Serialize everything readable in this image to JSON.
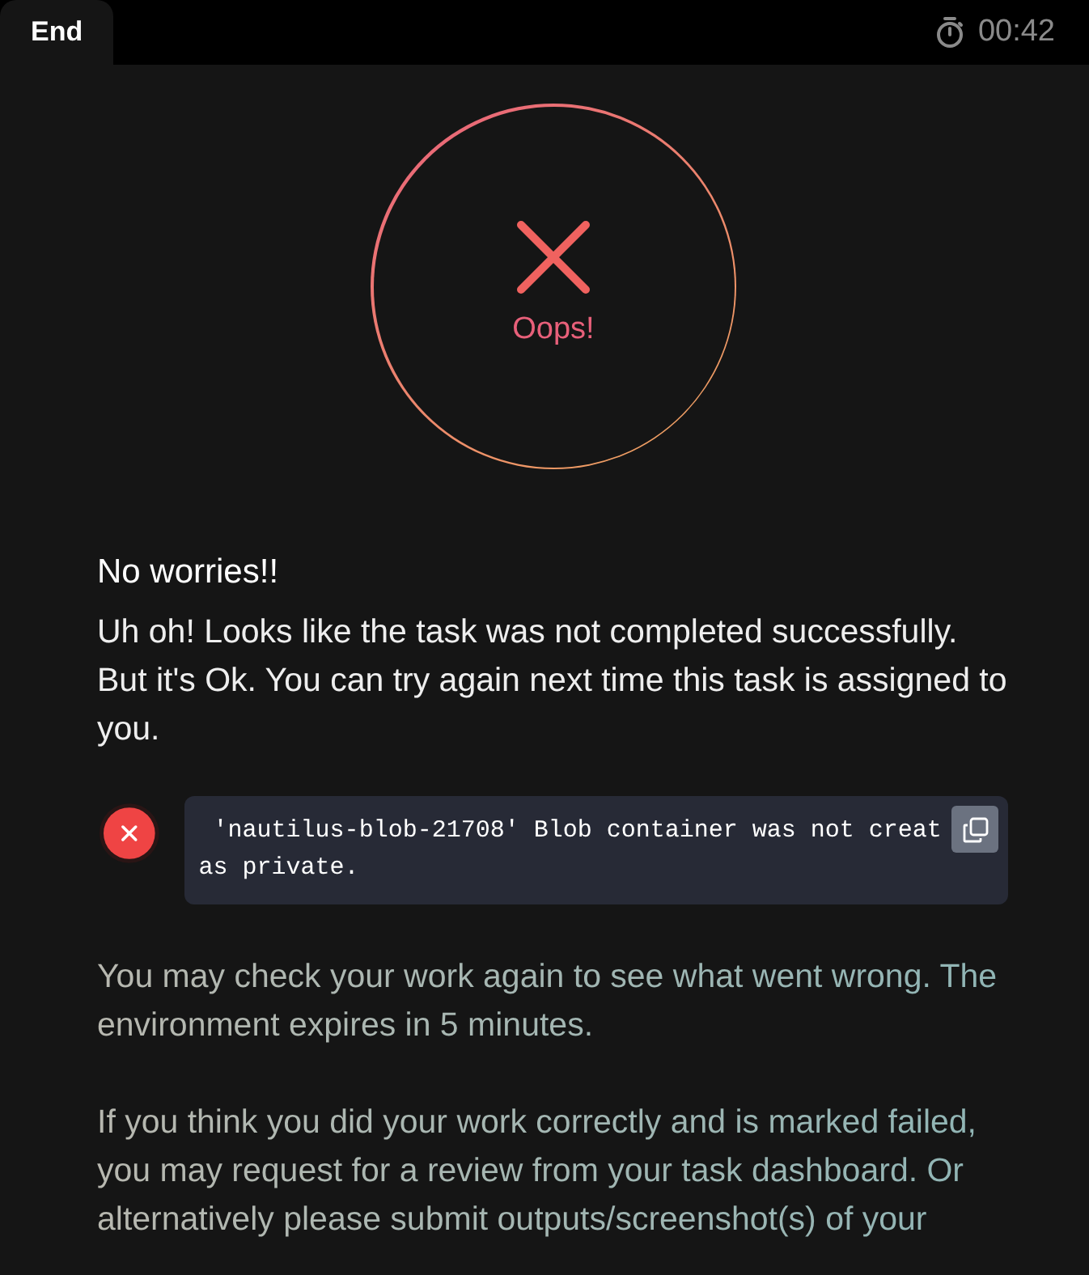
{
  "tabs": [
    {
      "label": "End",
      "selected": true
    }
  ],
  "timer": "00:42",
  "result": {
    "label": "Oops!"
  },
  "heading": "No worries!!",
  "message": "Uh oh! Looks like the task was not completed successfully. But it's Ok. You can try again next time this task is assigned to you.",
  "errors": [
    {
      "lines": [
        " 'nautilus-blob-21708' Blob container was not creat",
        "as private."
      ]
    }
  ],
  "notes": [
    "You may check your work again to see what went wrong. The environment expires in 5 minutes.",
    "If you think you did your work correctly and is marked failed, you may request for a review from your task dashboard. Or alternatively please submit outputs/screenshot(s) of your"
  ]
}
